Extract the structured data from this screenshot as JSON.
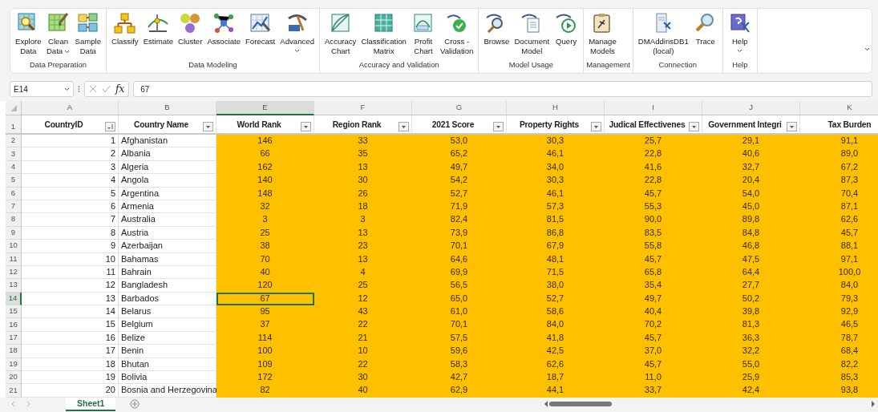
{
  "ribbon": {
    "groups": [
      {
        "label": "Data Preparation",
        "buttons": [
          {
            "label": "Explore\nData",
            "dropdown": false
          },
          {
            "label": "Clean\nData",
            "dropdown": true
          },
          {
            "label": "Sample\nData",
            "dropdown": false
          }
        ]
      },
      {
        "label": "Data Modeling",
        "buttons": [
          {
            "label": "Classify",
            "dropdown": false
          },
          {
            "label": "Estimate",
            "dropdown": false
          },
          {
            "label": "Cluster",
            "dropdown": false
          },
          {
            "label": "Associate",
            "dropdown": false
          },
          {
            "label": "Forecast",
            "dropdown": false
          },
          {
            "label": "Advanced",
            "dropdown": true
          }
        ]
      },
      {
        "label": "Accuracy and Validation",
        "buttons": [
          {
            "label": "Accuracy\nChart",
            "dropdown": false
          },
          {
            "label": "Classification\nMatrix",
            "dropdown": false
          },
          {
            "label": "Profit\nChart",
            "dropdown": false
          },
          {
            "label": "Cross -\nValidation",
            "dropdown": false
          }
        ]
      },
      {
        "label": "Model Usage",
        "buttons": [
          {
            "label": "Browse",
            "dropdown": false
          },
          {
            "label": "Document\nModel",
            "dropdown": false
          },
          {
            "label": "Query",
            "dropdown": false
          }
        ]
      },
      {
        "label": "Management",
        "buttons": [
          {
            "label": "Manage\nModels",
            "dropdown": false
          }
        ]
      },
      {
        "label": "Connection",
        "buttons": [
          {
            "label": "DMAddinsDB1\n(local)",
            "dropdown": false
          },
          {
            "label": "Trace",
            "dropdown": false
          }
        ]
      },
      {
        "label": "Help",
        "buttons": [
          {
            "label": "Help",
            "dropdown": true
          }
        ]
      }
    ]
  },
  "formula_bar": {
    "name_box": "E14",
    "function_label": "fx",
    "value": "67"
  },
  "sheet": {
    "header_row_number": "1",
    "columns": [
      {
        "letter": "A",
        "header": "CountryID",
        "kind": "number",
        "sorted": true,
        "filter_button": true,
        "highlighted": false,
        "selected": false
      },
      {
        "letter": "B",
        "header": "Country Name",
        "kind": "text",
        "sorted": false,
        "filter_button": true,
        "highlighted": false,
        "selected": false
      },
      {
        "letter": "E",
        "header": "World Rank",
        "kind": "value",
        "sorted": false,
        "filter_button": true,
        "highlighted": true,
        "selected": true
      },
      {
        "letter": "F",
        "header": "Region Rank",
        "kind": "value",
        "sorted": false,
        "filter_button": true,
        "highlighted": true,
        "selected": false
      },
      {
        "letter": "G",
        "header": "2021 Score",
        "kind": "value",
        "sorted": false,
        "filter_button": true,
        "highlighted": true,
        "selected": false
      },
      {
        "letter": "H",
        "header": "Property Rights",
        "kind": "value",
        "sorted": false,
        "filter_button": true,
        "highlighted": true,
        "selected": false
      },
      {
        "letter": "I",
        "header": "Judical Effectivenes",
        "kind": "value",
        "sorted": false,
        "filter_button": true,
        "highlighted": true,
        "selected": false
      },
      {
        "letter": "J",
        "header": "Government Integri",
        "kind": "value",
        "sorted": false,
        "filter_button": true,
        "highlighted": true,
        "selected": false
      },
      {
        "letter": "K",
        "header": "Tax Burden",
        "kind": "value",
        "filter_button": false,
        "highlighted": true,
        "selected": false
      }
    ],
    "rows": [
      {
        "number": "2",
        "selected": false,
        "cells": [
          "1",
          "Afghanistan",
          "146",
          "33",
          "53,0",
          "30,3",
          "25,7",
          "29,1",
          "91,1"
        ]
      },
      {
        "number": "3",
        "selected": false,
        "cells": [
          "2",
          "Albania",
          "66",
          "35",
          "65,2",
          "46,1",
          "22,8",
          "40,6",
          "89,0"
        ]
      },
      {
        "number": "4",
        "selected": false,
        "cells": [
          "3",
          "Algeria",
          "162",
          "13",
          "49,7",
          "34,0",
          "41,6",
          "32,7",
          "67,2"
        ]
      },
      {
        "number": "5",
        "selected": false,
        "cells": [
          "4",
          "Angola",
          "140",
          "30",
          "54,2",
          "30,3",
          "22,8",
          "20,4",
          "87,3"
        ]
      },
      {
        "number": "6",
        "selected": false,
        "cells": [
          "5",
          "Argentina",
          "148",
          "26",
          "52,7",
          "46,1",
          "45,7",
          "54,0",
          "70,4"
        ]
      },
      {
        "number": "7",
        "selected": false,
        "cells": [
          "6",
          "Armenia",
          "32",
          "18",
          "71,9",
          "57,3",
          "55,3",
          "45,0",
          "87,1"
        ]
      },
      {
        "number": "8",
        "selected": false,
        "cells": [
          "7",
          "Australia",
          "3",
          "3",
          "82,4",
          "81,5",
          "90,0",
          "89,8",
          "62,6"
        ]
      },
      {
        "number": "9",
        "selected": false,
        "cells": [
          "8",
          "Austria",
          "25",
          "13",
          "73,9",
          "86,8",
          "83,5",
          "84,8",
          "45,7"
        ]
      },
      {
        "number": "10",
        "selected": false,
        "cells": [
          "9",
          "Azerbaijan",
          "38",
          "23",
          "70,1",
          "67,9",
          "55,8",
          "46,8",
          "88,1"
        ]
      },
      {
        "number": "11",
        "selected": false,
        "cells": [
          "10",
          "Bahamas",
          "70",
          "13",
          "64,6",
          "48,1",
          "45,7",
          "47,5",
          "97,1"
        ]
      },
      {
        "number": "12",
        "selected": false,
        "cells": [
          "11",
          "Bahrain",
          "40",
          "4",
          "69,9",
          "71,5",
          "65,8",
          "64,4",
          "100,0"
        ]
      },
      {
        "number": "13",
        "selected": false,
        "cells": [
          "12",
          "Bangladesh",
          "120",
          "25",
          "56,5",
          "38,0",
          "35,4",
          "27,7",
          "84,0"
        ]
      },
      {
        "number": "14",
        "selected": true,
        "cells": [
          "13",
          "Barbados",
          "67",
          "12",
          "65,0",
          "52,7",
          "49,7",
          "50,2",
          "79,3"
        ]
      },
      {
        "number": "15",
        "selected": false,
        "cells": [
          "14",
          "Belarus",
          "95",
          "43",
          "61,0",
          "58,6",
          "40,4",
          "39,8",
          "92,9"
        ]
      },
      {
        "number": "16",
        "selected": false,
        "cells": [
          "15",
          "Belgium",
          "37",
          "22",
          "70,1",
          "84,0",
          "70,2",
          "81,3",
          "46,5"
        ]
      },
      {
        "number": "17",
        "selected": false,
        "cells": [
          "16",
          "Belize",
          "114",
          "21",
          "57,5",
          "41,8",
          "45,7",
          "36,3",
          "78,7"
        ]
      },
      {
        "number": "18",
        "selected": false,
        "cells": [
          "17",
          "Benin",
          "100",
          "10",
          "59,6",
          "42,5",
          "37,0",
          "32,2",
          "68,4"
        ]
      },
      {
        "number": "19",
        "selected": false,
        "cells": [
          "18",
          "Bhutan",
          "109",
          "22",
          "58,3",
          "62,6",
          "45,7",
          "55,0",
          "82,2"
        ]
      },
      {
        "number": "20",
        "selected": false,
        "cells": [
          "19",
          "Bolivia",
          "172",
          "30",
          "42,7",
          "18,7",
          "11,0",
          "25,9",
          "85,3"
        ]
      },
      {
        "number": "21",
        "selected": false,
        "cells": [
          "20",
          "Bosnia and Herzegovina",
          "82",
          "40",
          "62,9",
          "44,1",
          "33,7",
          "42,4",
          "93,8"
        ]
      }
    ]
  },
  "sheet_tabs": [
    {
      "label": "Sheet1",
      "selected": true
    }
  ]
}
